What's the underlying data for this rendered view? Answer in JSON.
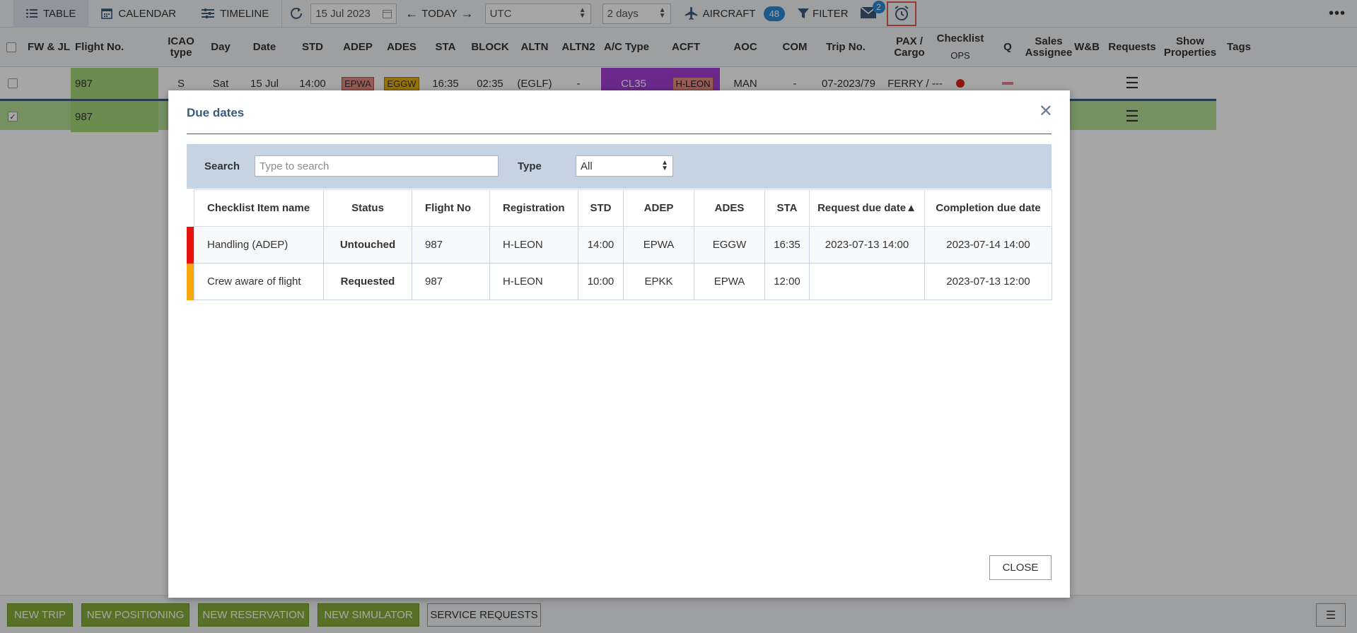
{
  "toolbar": {
    "views": [
      {
        "label": "TABLE",
        "icon": "list-icon",
        "active": true
      },
      {
        "label": "CALENDAR",
        "icon": "calendar-icon",
        "active": false
      },
      {
        "label": "TIMELINE",
        "icon": "timeline-icon",
        "active": false
      }
    ],
    "date_value": "15 Jul 2023",
    "today_label": "TODAY",
    "timezone_value": "UTC",
    "range_value": "2 days",
    "aircraft_label": "AIRCRAFT",
    "aircraft_count": "48",
    "filter_label": "FILTER",
    "mail_count": "2"
  },
  "grid": {
    "headers": {
      "fw_jl": "FW & JL",
      "flight_no": "Flight No.",
      "icao_type": "ICAO type",
      "day": "Day",
      "date": "Date",
      "std": "STD",
      "adep": "ADEP",
      "ades": "ADES",
      "sta": "STA",
      "block": "BLOCK",
      "altn": "ALTN",
      "altn2": "ALTN2",
      "ac_type": "A/C Type",
      "acft": "ACFT",
      "aoc": "AOC",
      "com": "COM",
      "trip_no": "Trip No.",
      "pax_cargo": "PAX / Cargo",
      "checklist": "Checklist",
      "checklist_sub": "OPS",
      "q": "Q",
      "sales_assignee": "Sales Assignee",
      "wb": "W&B",
      "requests": "Requests",
      "show_properties": "Show Properties",
      "tags": "Tags"
    },
    "rows": [
      {
        "flight_no": "987",
        "icao_type": "S",
        "day": "Sat",
        "date": "15 Jul",
        "std": "14:00",
        "adep": "EPWA",
        "ades": "EGGW",
        "sta": "16:35",
        "block": "02:35",
        "altn": "(EGLF)",
        "altn2": "-",
        "ac_type": "CL35",
        "acft": "H-LEON",
        "aoc": "MAN",
        "com": "-",
        "trip_no": "07-2023/79",
        "pax_cargo": "FERRY / ---"
      },
      {
        "flight_no": "987"
      }
    ]
  },
  "modal": {
    "title": "Due dates",
    "search_label": "Search",
    "search_placeholder": "Type to search",
    "type_label": "Type",
    "type_value": "All",
    "columns": [
      "Checklist Item name",
      "Status",
      "Flight No",
      "Registration",
      "STD",
      "ADEP",
      "ADES",
      "STA",
      "Request due date▲",
      "Completion due date"
    ],
    "rows": [
      {
        "item": "Handling (ADEP)",
        "status": "Untouched",
        "flight_no": "987",
        "registration": "H-LEON",
        "std": "14:00",
        "adep": "EPWA",
        "ades": "EGGW",
        "sta": "16:35",
        "request_due": "2023-07-13 14:00",
        "completion_due": "2023-07-14 14:00",
        "marker_color": "#e8120c"
      },
      {
        "item": "Crew aware of flight",
        "status": "Requested",
        "flight_no": "987",
        "registration": "H-LEON",
        "std": "10:00",
        "adep": "EPKK",
        "ades": "EPWA",
        "sta": "12:00",
        "request_due": "",
        "completion_due": "2023-07-13 12:00",
        "marker_color": "#f5a70d"
      }
    ],
    "close_label": "CLOSE"
  },
  "bottom_bar": {
    "buttons": [
      "NEW TRIP",
      "NEW POSITIONING",
      "NEW RESERVATION",
      "NEW SIMULATOR",
      "SERVICE REQUESTS"
    ]
  },
  "colors": {
    "accent_green": "#86b03c",
    "row_green": "#a6d67a",
    "ac_purple": "#a33fd6",
    "status_red": "#e0221b",
    "status_orange": "#f0a30e",
    "badge_blue": "#2a8ad6"
  }
}
